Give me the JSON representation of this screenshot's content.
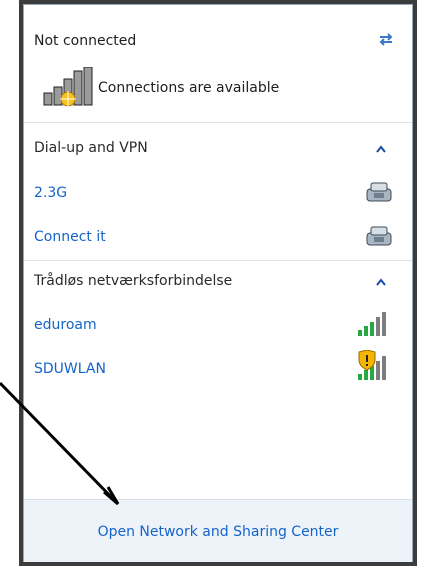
{
  "status": {
    "title": "Not connected",
    "connections_text": "Connections are available"
  },
  "sections": [
    {
      "header": "Dial-up and VPN",
      "items": [
        {
          "label": "2.3G",
          "icon": "dialup-connection-icon"
        },
        {
          "label": "Connect it",
          "icon": "dialup-connection-icon"
        }
      ]
    },
    {
      "header": "Trådløs netværksforbindelse",
      "items": [
        {
          "label": "eduroam",
          "icon": "wifi-signal-icon"
        },
        {
          "label": "SDUWLAN",
          "icon": "wifi-signal-shield-icon"
        }
      ]
    }
  ],
  "footer": {
    "link": "Open Network and Sharing Center"
  },
  "colors": {
    "link": "#1464c8",
    "footer_bg": "#eef3fa",
    "frame": "#3c3c3c"
  }
}
